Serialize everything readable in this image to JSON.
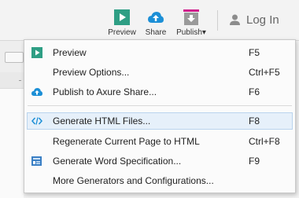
{
  "toolbar": {
    "preview_label": "Preview",
    "share_label": "Share",
    "publish_label": "Publish",
    "publish_caret": "▾",
    "login_label": "Log In"
  },
  "menu": {
    "items": [
      {
        "label": "Preview",
        "shortcut": "F5",
        "icon": "play-icon"
      },
      {
        "label": "Preview Options...",
        "shortcut": "Ctrl+F5"
      },
      {
        "label": "Publish to Axure Share...",
        "shortcut": "F6",
        "icon": "cloud-upload-icon"
      },
      {
        "label": "Generate HTML Files...",
        "shortcut": "F8",
        "icon": "code-icon",
        "highlighted": true
      },
      {
        "label": "Regenerate Current Page to HTML",
        "shortcut": "Ctrl+F8"
      },
      {
        "label": "Generate Word Specification...",
        "shortcut": "F9",
        "icon": "document-icon"
      },
      {
        "label": "More Generators and Configurations..."
      }
    ]
  },
  "colors": {
    "accent_green": "#2e9e84",
    "accent_blue": "#1c8fd6",
    "publish_magenta": "#d0208c",
    "highlight_bg": "#e6f0fa"
  }
}
